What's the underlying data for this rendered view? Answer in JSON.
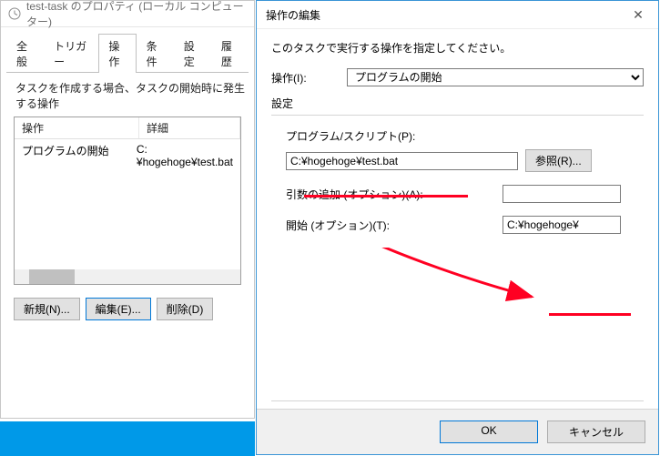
{
  "props_window": {
    "title": "test-task のプロパティ (ローカル コンピューター)",
    "tabs": [
      "全般",
      "トリガー",
      "操作",
      "条件",
      "設定",
      "履歴"
    ],
    "active_tab_index": 2,
    "subtitle": "タスクを作成する場合、タスクの開始時に発生する操作",
    "list": {
      "columns": [
        "操作",
        "詳細"
      ],
      "rows": [
        {
          "op": "プログラムの開始",
          "detail": "C:¥hogehoge¥test.bat"
        }
      ]
    },
    "buttons": {
      "new": "新規(N)...",
      "edit": "編集(E)...",
      "delete": "削除(D)"
    }
  },
  "edit_window": {
    "title": "操作の編集",
    "instruction": "このタスクで実行する操作を指定してください。",
    "action_label": "操作(I):",
    "action_value": "プログラムの開始",
    "settings_title": "設定",
    "program_label": "プログラム/スクリプト(P):",
    "program_value": "C:¥hogehoge¥test.bat",
    "browse": "参照(R)...",
    "args_label": "引数の追加 (オプション)(A):",
    "args_value": "",
    "startin_label": "開始 (オプション)(T):",
    "startin_value": "C:¥hogehoge¥",
    "ok": "OK",
    "cancel": "キャンセル"
  }
}
